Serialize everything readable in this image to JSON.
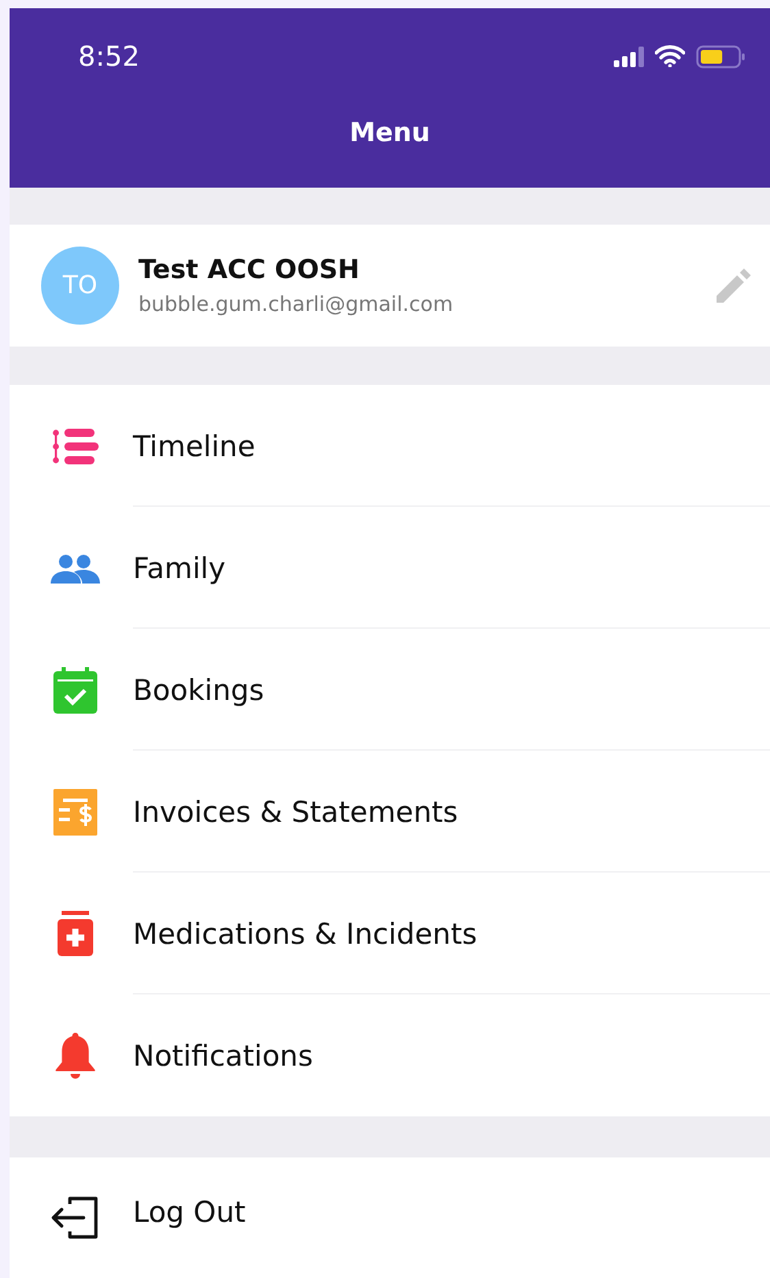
{
  "status_bar": {
    "time": "8:52"
  },
  "header": {
    "title": "Menu"
  },
  "profile": {
    "initials": "TO",
    "name": "Test ACC OOSH",
    "email": "bubble.gum.charli@gmail.com"
  },
  "menu_items": [
    {
      "kind": "timeline",
      "label": "Timeline"
    },
    {
      "kind": "family",
      "label": "Family"
    },
    {
      "kind": "bookings",
      "label": "Bookings"
    },
    {
      "kind": "invoices",
      "label": "Invoices & Statements"
    },
    {
      "kind": "medications",
      "label": "Medications & Incidents"
    },
    {
      "kind": "notifications",
      "label": "Notifications"
    }
  ],
  "logout": {
    "label": "Log Out"
  }
}
